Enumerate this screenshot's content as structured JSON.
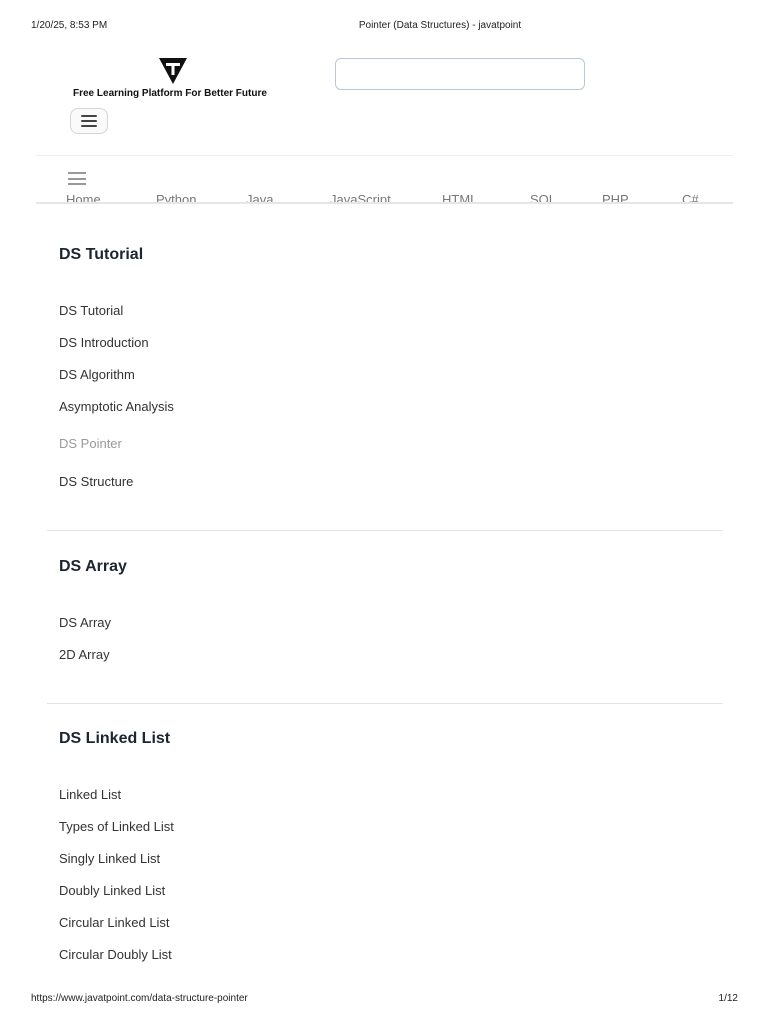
{
  "print_header": {
    "datetime": "1/20/25, 8:53 PM",
    "title": "Pointer (Data Structures) - javatpoint"
  },
  "print_footer": {
    "url": "https://www.javatpoint.com/data-structure-pointer",
    "page": "1/12"
  },
  "header": {
    "tagline": "Free Learning Platform For Better Future",
    "search_placeholder": "",
    "logo_icon": "javatpoint-logo-icon",
    "menu_icon": "hamburger-icon"
  },
  "nav": {
    "links": [
      "Home",
      "Python",
      "Java",
      "JavaScript",
      "HTML",
      "SQL",
      "PHP",
      "C#"
    ]
  },
  "sidebar": {
    "sections": [
      {
        "heading": "DS Tutorial",
        "items": [
          "DS Tutorial",
          "DS Introduction",
          "DS Algorithm",
          "Asymptotic Analysis",
          "DS Pointer",
          "DS Structure"
        ],
        "active": "DS Pointer"
      },
      {
        "heading": "DS Array",
        "items": [
          "DS Array",
          "2D Array"
        ]
      },
      {
        "heading": "DS Linked List",
        "items": [
          "Linked List",
          "Types of Linked List",
          "Singly Linked List",
          "Doubly Linked List",
          "Circular Linked List",
          "Circular Doubly List"
        ]
      }
    ]
  }
}
